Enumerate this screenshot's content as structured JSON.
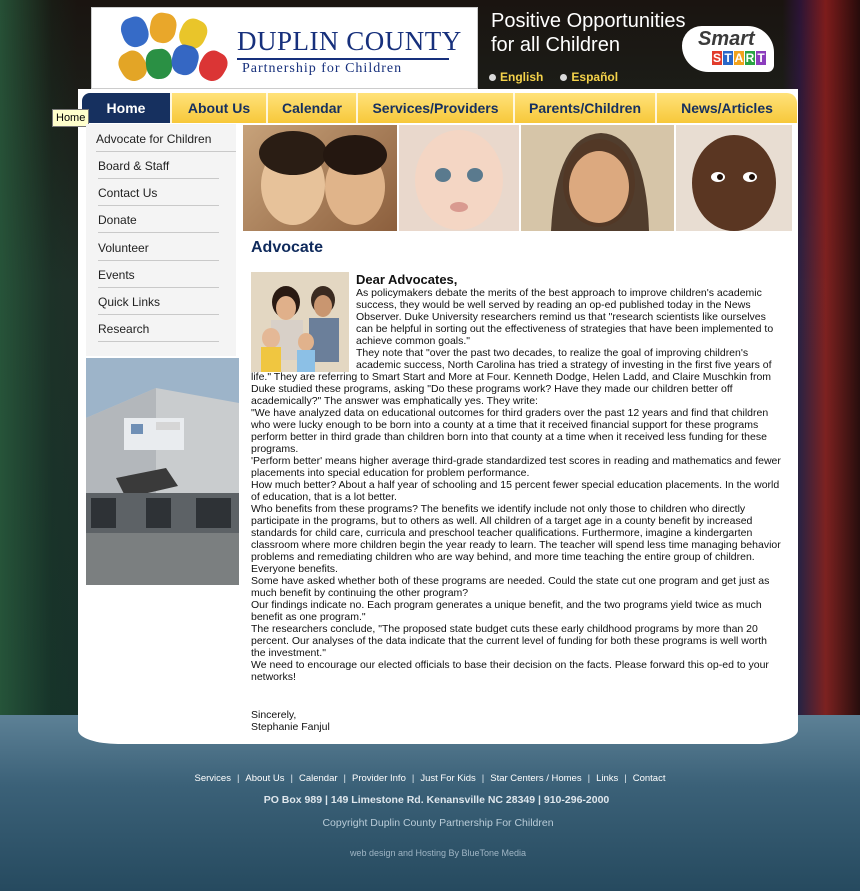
{
  "header": {
    "logo_line1": "DUPLIN COUNTY",
    "logo_line2": "Partnership for Children",
    "tagline_line1": "Positive Opportunities",
    "tagline_line2": "for all Children",
    "languages": [
      "English",
      "Español"
    ],
    "smartstart_word1": "Smart",
    "smartstart_letters": [
      "S",
      "T",
      "A",
      "R",
      "T"
    ],
    "smartstart_colors": [
      "#e23b2b",
      "#2a67c8",
      "#f1a21c",
      "#2aa343",
      "#8b3dbd"
    ]
  },
  "nav": {
    "items": [
      "Home",
      "About Us",
      "Calendar",
      "Services/Providers",
      "Parents/Children",
      "News/Articles"
    ],
    "active": "Home",
    "tooltip": "Home"
  },
  "sidebar": {
    "items": [
      "Advocate for Children",
      "Board & Staff",
      "Contact Us",
      "Donate",
      "Volunteer",
      "Events",
      "Quick Links",
      "Research"
    ]
  },
  "article": {
    "title": "Advocate",
    "greeting": "Dear Advocates,",
    "paragraphs": [
      "As policymakers debate the merits of the best approach to improve children's academic success, they would be well served by reading an op-ed published today in the News Observer. Duke University researchers remind us that \"research scientists like ourselves can be helpful in sorting out the effectiveness of strategies that have been implemented to achieve common goals.\"",
      "They note that \"over the past two decades, to realize the goal of improving children's academic success, North Carolina has tried a strategy of investing in the first five years of life.\" They are referring to Smart Start and More at Four. Kenneth Dodge, Helen Ladd, and Claire Muschkin from Duke studied these programs, asking \"Do these programs work? Have they made our children better off academically?\" The answer was emphatically yes. They write:",
      "\"We have analyzed data on educational outcomes for third graders over the past 12 years and find that children who were lucky enough to be born into a county at a time that it received financial support for these programs perform better in third grade than children born into that county at a time when it received less funding for these programs.",
      "'Perform better' means higher average third-grade standardized test scores in reading and mathematics and fewer placements into special education for problem performance.",
      "How much better? About a half year of schooling and 15 percent fewer special education placements. In the world of education, that is a lot better.",
      "Who benefits from these programs? The benefits we identify include not only those to children who directly participate in the programs, but to others as well. All children of a target age in a county benefit by increased standards for child care, curricula and preschool teacher qualifications. Furthermore, imagine a kindergarten classroom where more children begin the year ready to learn. The teacher will spend less time managing behavior problems and remediating children who are way behind, and more time teaching the entire group of children. Everyone benefits.",
      "Some have asked whether both of these programs are needed. Could the state cut one program and get just as much benefit by continuing the other program?",
      "Our findings indicate no. Each program generates a unique benefit, and the two programs yield twice as much benefit as one program.\"",
      "The researchers conclude, \"The proposed state budget cuts these early childhood programs by more than 20 percent. Our analyses of the data indicate that the current level of funding for both these programs is well worth the investment.\"",
      "We need to encourage our elected officials to base their decision on the facts. Please forward this op-ed to your networks!"
    ],
    "closing": "Sincerely,",
    "signature": "Stephanie Fanjul"
  },
  "footer": {
    "links": [
      "Services",
      "About Us",
      "Calendar",
      "Provider Info",
      "Just For Kids",
      "Star Centers / Homes",
      "Links",
      "Contact"
    ],
    "address": "PO Box 989 | 149 Limestone Rd. Kenansville NC 28349 | 910-296-2000",
    "copyright": "Copyright Duplin County Partnership For Children",
    "credit": "web design and Hosting By BlueTone Media"
  }
}
